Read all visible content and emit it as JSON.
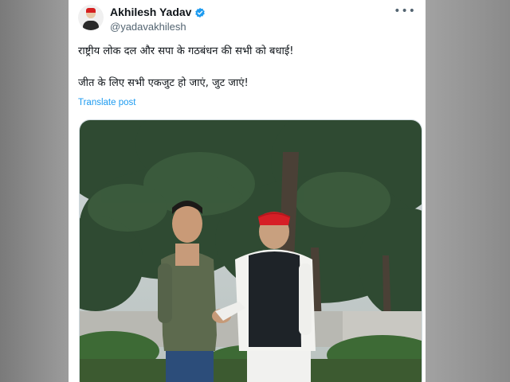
{
  "post": {
    "author_name": "Akhilesh Yadav",
    "author_handle": "@yadavakhilesh",
    "more_icon": "more-horizontal-icon",
    "verified_icon": "verified-badge-icon",
    "text_line_1": "राष्ट्रीय लोक दल और सपा के गठबंधन की सभी को बधाई!",
    "text_line_2": "जीत के लिए सभी एकजुट हो जाएं, जुट जाएं!",
    "translate_label": "Translate post"
  },
  "colors": {
    "link": "#1d9bf0",
    "verified": "#1d9bf0",
    "text": "#0f1419",
    "secondary": "#536471"
  }
}
